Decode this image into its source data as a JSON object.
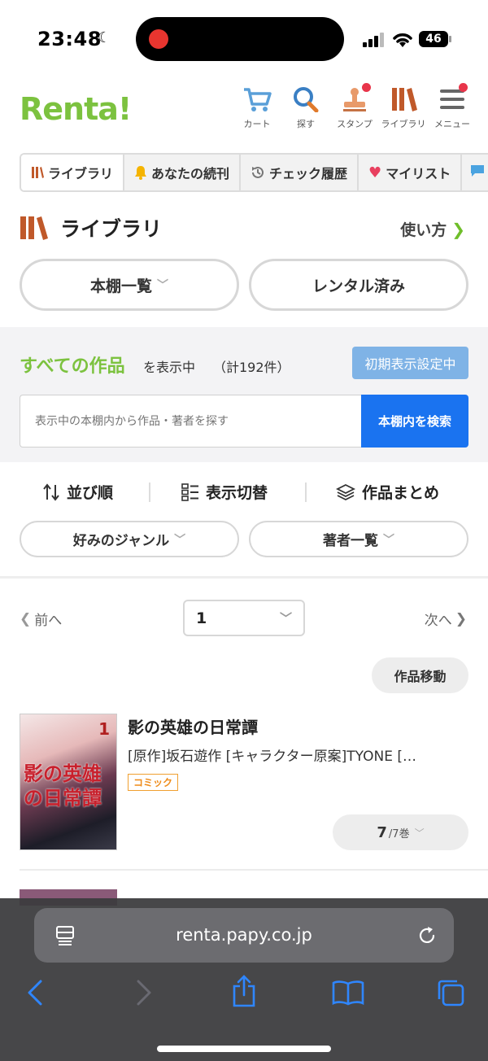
{
  "status": {
    "time": "23:48",
    "battery": "46"
  },
  "header": {
    "logo": "Renta!",
    "nav": [
      {
        "label": "カート",
        "icon": "cart-icon"
      },
      {
        "label": "探す",
        "icon": "search-icon"
      },
      {
        "label": "スタンプ",
        "icon": "stamp-icon"
      },
      {
        "label": "ライブラリ",
        "icon": "library-icon"
      },
      {
        "label": "メニュー",
        "icon": "menu-icon"
      }
    ]
  },
  "tabs": [
    {
      "label": "ライブラリ",
      "icon": "library-icon"
    },
    {
      "label": "あなたの続刊",
      "icon": "bell-icon"
    },
    {
      "label": "チェック履歴",
      "icon": "history-icon"
    },
    {
      "label": "マイリスト",
      "icon": "heart-icon"
    }
  ],
  "library": {
    "title": "ライブラリ",
    "howto": "使い方"
  },
  "shelf_buttons": {
    "shelf_list": "本棚一覧",
    "rented": "レンタル済み"
  },
  "filter": {
    "all_works": "すべての作品",
    "showing": "を表示中",
    "total": "（計192件）",
    "default_setting": "初期表示設定中",
    "search_placeholder": "表示中の本棚内から作品・著者を探す",
    "search_button": "本棚内を検索"
  },
  "toolbar": {
    "sort": "並び順",
    "display": "表示切替",
    "group": "作品まとめ"
  },
  "dropdowns": {
    "genre": "好みのジャンル",
    "authors": "著者一覧"
  },
  "pagination": {
    "prev": "前へ",
    "page": "1",
    "next": "次へ"
  },
  "move_button": "作品移動",
  "book": {
    "title": "影の英雄の日常譚",
    "authors": "[原作]坂石遊作 [キャラクター原案]TYONE […",
    "badge": "コミック",
    "cover_number": "1",
    "cover_title": "影の英雄の日常譚",
    "volumes_owned": "7",
    "volumes_total": "/7巻"
  },
  "safari": {
    "url": "renta.papy.co.jp"
  },
  "colors": {
    "brand_green": "#7cc23f",
    "search_blue": "#1a73f0",
    "default_btn": "#7fb3e6",
    "library_brown": "#c0592a"
  }
}
